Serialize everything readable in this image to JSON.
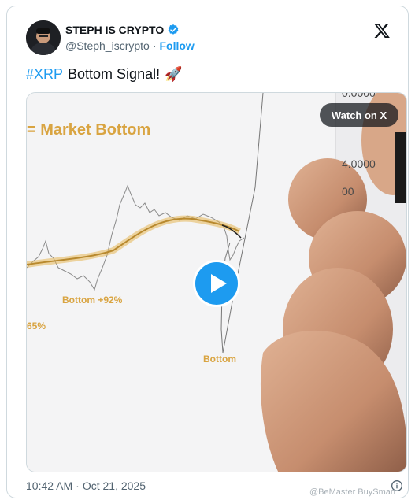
{
  "author": {
    "name": "STEPH IS CRYPTO",
    "handle": "@Steph_iscrypto",
    "separator": "·",
    "follow_label": "Follow",
    "verified_icon": "verified-badge-icon"
  },
  "tweet": {
    "hashtag": "#XRP",
    "text": "Bottom Signal!",
    "emoji": "🚀"
  },
  "media": {
    "watch_label": "Watch on X",
    "labels": {
      "market_bottom": "= Market Bottom",
      "bottom_92": "Bottom +92%",
      "pct_65": "65%",
      "bottom": "Bottom"
    },
    "axis": {
      "top": "0.0000",
      "mid": "4.0000",
      "low": "00"
    }
  },
  "footer": {
    "time": "10:42 AM",
    "separator": "·",
    "date": "Oct 21, 2025"
  },
  "watermark": "@BeMaster BuySmart",
  "colors": {
    "accent": "#1d9bf0",
    "chart_gold": "#d9a441"
  }
}
